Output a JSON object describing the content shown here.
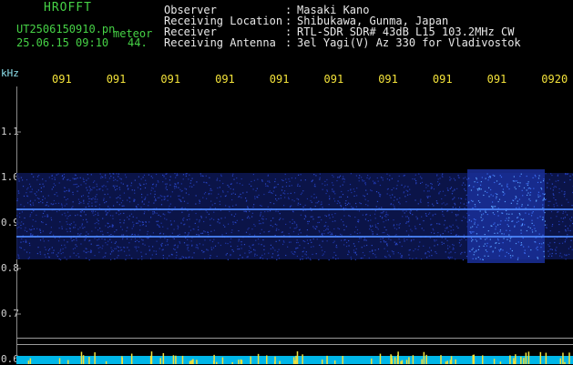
{
  "header": {
    "title": "HROFFT",
    "filename": "UT2506150910.pn",
    "meteor_label": "meteor",
    "datetime": "25.06.15 09:10",
    "count": "44.",
    "fields": [
      {
        "label": "Observer",
        "sep": ":",
        "value": "Masaki Kano"
      },
      {
        "label": "Receiving Location",
        "sep": ":",
        "value": "Shibukawa, Gunma, Japan"
      },
      {
        "label": "Receiver",
        "sep": ":",
        "value": "RTL-SDR SDR# 43dB L15 103.2MHz CW"
      },
      {
        "label": "Receiving Antenna",
        "sep": ":",
        "value": "3el Yagi(V) Az 330 for Vladivostok"
      }
    ]
  },
  "chart_data": {
    "type": "heatmap",
    "y_unit": "kHz",
    "x_tick_labels": [
      "091",
      "091",
      "091",
      "091",
      "091",
      "091",
      "091",
      "091",
      "091",
      "0920"
    ],
    "y_tick_labels": [
      "1.1",
      "1.0",
      "0.9",
      "0.8",
      "0.7",
      "0.6"
    ],
    "y_ticks": [
      1.1,
      1.0,
      0.9,
      0.8,
      0.7,
      0.6
    ],
    "ylim": [
      0.59,
      1.2
    ],
    "signal_lines_khz": [
      0.93,
      0.87
    ],
    "band_khz": [
      0.82,
      1.01
    ],
    "colors": {
      "band": "#1a2f9a",
      "signal": "#4f8aff",
      "noise_floor": "#00b7e8",
      "spikes": "#f3e23a"
    }
  }
}
